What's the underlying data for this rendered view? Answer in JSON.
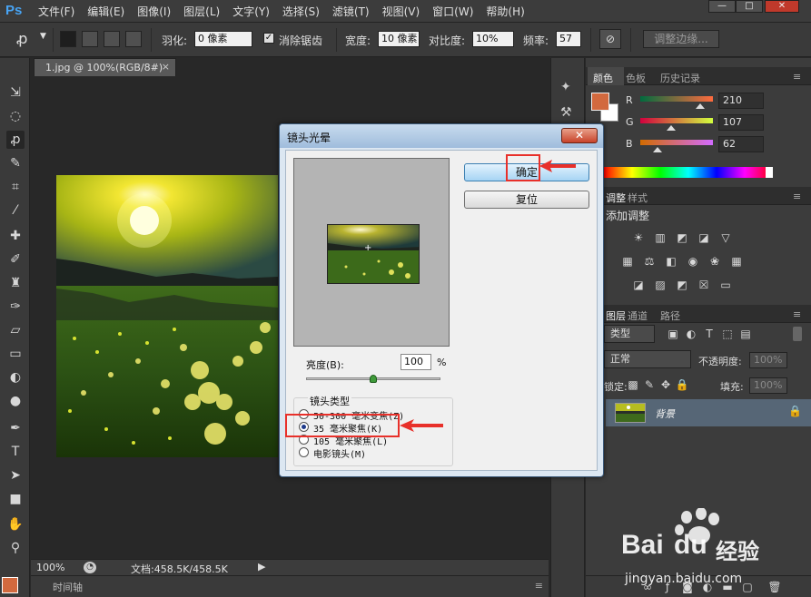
{
  "app": {
    "logo": "Ps"
  },
  "menu": [
    "文件(F)",
    "编辑(E)",
    "图像(I)",
    "图层(L)",
    "文字(Y)",
    "选择(S)",
    "滤镜(T)",
    "视图(V)",
    "窗口(W)",
    "帮助(H)"
  ],
  "window_controls": {
    "minimize": "—",
    "maximize": "□",
    "close": "✕"
  },
  "options_bar": {
    "feather_label": "羽化:",
    "feather_value": "0 像素",
    "antialias_label": "消除锯齿",
    "antialias_checked": "✓",
    "width_label": "宽度:",
    "width_value": "10 像素",
    "contrast_label": "对比度:",
    "contrast_value": "10%",
    "frequency_label": "频率:",
    "frequency_value": "57",
    "refine_edge": "调整边缘..."
  },
  "document": {
    "tab_title": "1.jpg @ 100%(RGB/8#)",
    "tab_close": "×",
    "zoom": "100%",
    "doc_size": "文档:458.5K/458.5K",
    "timeline": "时间轴"
  },
  "color_panel": {
    "tabs": [
      "颜色",
      "色板",
      "历史记录"
    ],
    "channels": [
      {
        "label": "R",
        "value": "210",
        "fraction": 0.82
      },
      {
        "label": "G",
        "value": "107",
        "fraction": 0.42
      },
      {
        "label": "B",
        "value": "62",
        "fraction": 0.24
      }
    ],
    "fg_color": "#d2693e"
  },
  "adjustments_panel": {
    "tabs": [
      "调整",
      "样式"
    ],
    "title": "添加调整"
  },
  "layers_panel": {
    "tabs": [
      "图层",
      "通道",
      "路径"
    ],
    "kind_filter": "类型",
    "blend_mode": "正常",
    "opacity_label": "不透明度:",
    "opacity_value": "100%",
    "lock_label": "锁定:",
    "fill_label": "填充:",
    "fill_value": "100%",
    "layer_name": "背景"
  },
  "dialog": {
    "title": "镜头光晕",
    "close": "✕",
    "ok_button": "确定",
    "reset_button": "复位",
    "brightness_label": "亮度(B):",
    "brightness_value": "100",
    "brightness_unit": "%",
    "brightness_fraction": 0.5,
    "lens_type_title": "镜头类型",
    "lens_options": [
      {
        "label": "50-300 毫米变焦(Z)",
        "selected": false
      },
      {
        "label": "35 毫米聚焦(K)",
        "selected": true
      },
      {
        "label": "105 毫米聚焦(L)",
        "selected": false
      },
      {
        "label": "电影镜头(M)",
        "selected": false
      }
    ]
  },
  "watermark": {
    "brand": "Bai",
    "brand2": "du",
    "label": "经验",
    "url": "jingyan.baidu.com"
  }
}
